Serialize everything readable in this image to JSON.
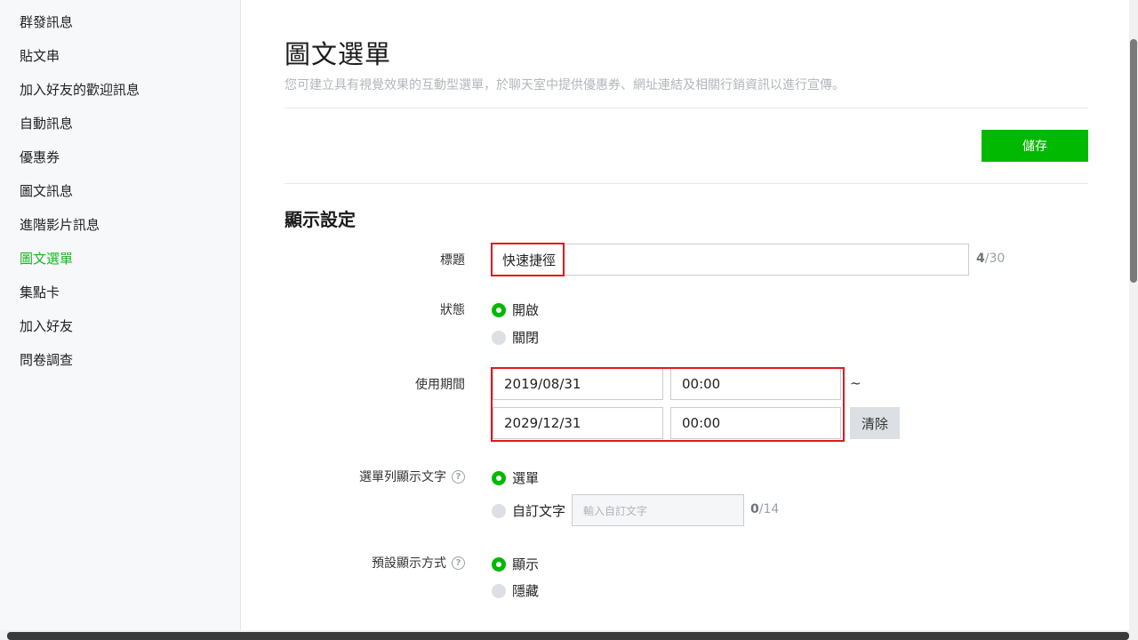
{
  "sidebar": {
    "items": [
      {
        "label": "群發訊息"
      },
      {
        "label": "貼文串"
      },
      {
        "label": "加入好友的歡迎訊息"
      },
      {
        "label": "自動訊息"
      },
      {
        "label": "優惠券"
      },
      {
        "label": "圖文訊息"
      },
      {
        "label": "進階影片訊息"
      },
      {
        "label": "圖文選單",
        "active": true
      },
      {
        "label": "集點卡"
      },
      {
        "label": "加入好友"
      },
      {
        "label": "問卷調查"
      }
    ]
  },
  "header": {
    "title": "圖文選單",
    "description": "您可建立具有視覺效果的互動型選單，於聊天室中提供優惠券、網址連結及相關行銷資訊以進行宣傳。"
  },
  "toolbar": {
    "save_label": "儲存"
  },
  "display_settings": {
    "section_title": "顯示設定",
    "title_field": {
      "label": "標題",
      "value": "快速捷徑",
      "count": "4",
      "max": "/30"
    },
    "status": {
      "label": "狀態",
      "options": [
        "開啟",
        "關閉"
      ],
      "selected": "開啟"
    },
    "period": {
      "label": "使用期間",
      "start_date": "2019/08/31",
      "start_time": "00:00",
      "end_date": "2029/12/31",
      "end_time": "00:00",
      "separator": "~",
      "clear_label": "清除"
    },
    "menu_bar_text": {
      "label": "選單列顯示文字",
      "options": [
        "選單",
        "自訂文字"
      ],
      "selected": "選單",
      "custom_placeholder": "輸入自訂文字",
      "count": "0",
      "max": "/14"
    },
    "default_display": {
      "label": "預設顯示方式",
      "options": [
        "顯示",
        "隱藏"
      ],
      "selected": "顯示"
    }
  },
  "colors": {
    "accent": "#00b900",
    "active_text": "#18b61c",
    "highlight": "#e0191e"
  },
  "icons": {
    "help": "question-circle-icon"
  }
}
